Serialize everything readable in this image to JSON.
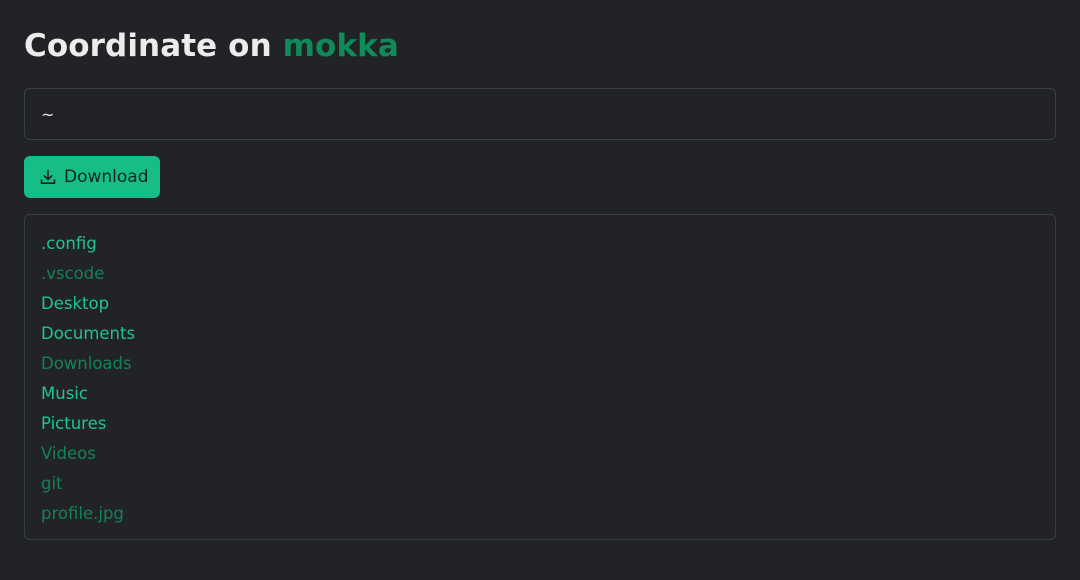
{
  "header": {
    "prefix": "Coordinate on",
    "host": "mokka"
  },
  "path_input": {
    "value": "~"
  },
  "download_button": {
    "label": "Download",
    "icon": "download-icon"
  },
  "entries": [
    {
      "name": ".config",
      "style": "bright"
    },
    {
      "name": ".vscode",
      "style": "dim"
    },
    {
      "name": "Desktop",
      "style": "bright"
    },
    {
      "name": "Documents",
      "style": "bright"
    },
    {
      "name": "Downloads",
      "style": "dim"
    },
    {
      "name": "Music",
      "style": "bright"
    },
    {
      "name": "Pictures",
      "style": "bright"
    },
    {
      "name": "Videos",
      "style": "dim"
    },
    {
      "name": "git",
      "style": "dim"
    },
    {
      "name": "profile.jpg",
      "style": "dim"
    }
  ],
  "colors": {
    "background": "#212327",
    "accent": "#17bd86",
    "host": "#0f8a58",
    "entry_bright": "#1ec68d",
    "entry_dim": "#138258"
  }
}
